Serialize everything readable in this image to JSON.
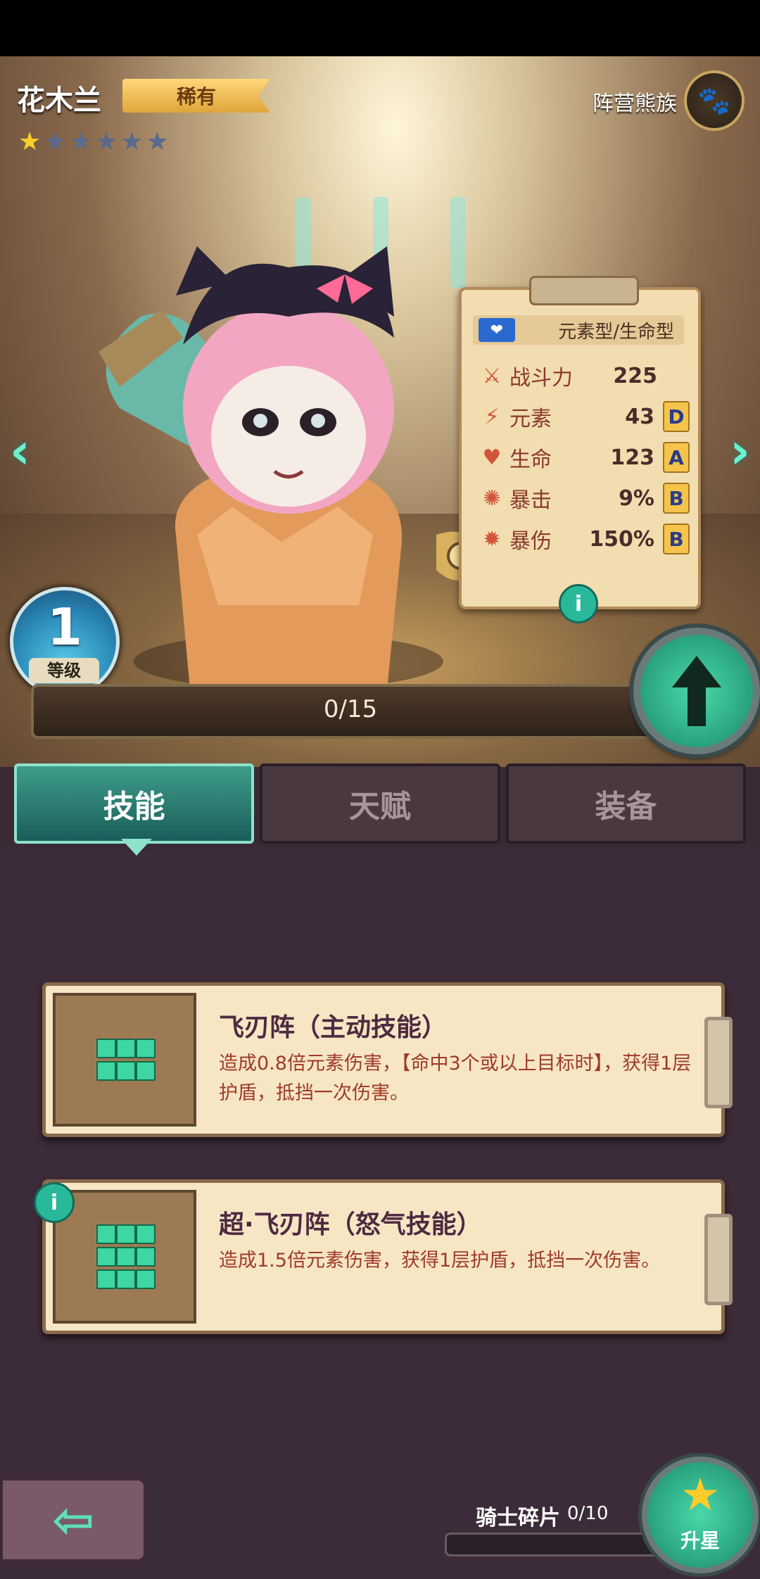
{
  "hero": {
    "name": "花木兰",
    "rarity": "稀有",
    "stars_filled": 1,
    "stars_total": 6,
    "faction": "阵营熊族",
    "faction_icon": "paw-icon"
  },
  "stats": {
    "type": "元素型/生命型",
    "rows": [
      {
        "label": "战斗力",
        "value": "225",
        "grade": "",
        "icon": "sword-icon"
      },
      {
        "label": "元素",
        "value": "43",
        "grade": "D",
        "icon": "lightning-icon"
      },
      {
        "label": "生命",
        "value": "123",
        "grade": "A",
        "icon": "heart-icon"
      },
      {
        "label": "暴击",
        "value": "9%",
        "grade": "B",
        "icon": "crit-icon"
      },
      {
        "label": "暴伤",
        "value": "150%",
        "grade": "B",
        "icon": "crit-damage-icon"
      }
    ],
    "info_glyph": "i"
  },
  "level": {
    "value": "1",
    "label": "等级",
    "xp": "0/15",
    "xp_fraction": 0
  },
  "tabs": {
    "skills": "技能",
    "talents": "天赋",
    "equipment": "装备"
  },
  "skills": [
    {
      "title": "飞刃阵（主动技能）",
      "desc": "造成0.8倍元素伤害，【命中3个或以上目标时】，获得1层护盾，抵挡一次伤害。",
      "pattern": [
        [
          1,
          1,
          1
        ],
        [
          1,
          1,
          1
        ]
      ]
    },
    {
      "title": "超·飞刃阵（怒气技能）",
      "desc": "造成1.5倍元素伤害，获得1层护盾，抵挡一次伤害。",
      "pattern": [
        [
          1,
          1,
          1
        ],
        [
          1,
          1,
          1
        ],
        [
          1,
          1,
          1
        ]
      ]
    }
  ],
  "footer": {
    "shard_label": "骑士碎片",
    "shard_count": "0/10",
    "shard_fraction": 0,
    "star_up_label": "升星"
  },
  "colors": {
    "accent_teal": "#3ed6a2",
    "gold": "#ffcc2a",
    "panel_bg": "#3c2b38"
  }
}
